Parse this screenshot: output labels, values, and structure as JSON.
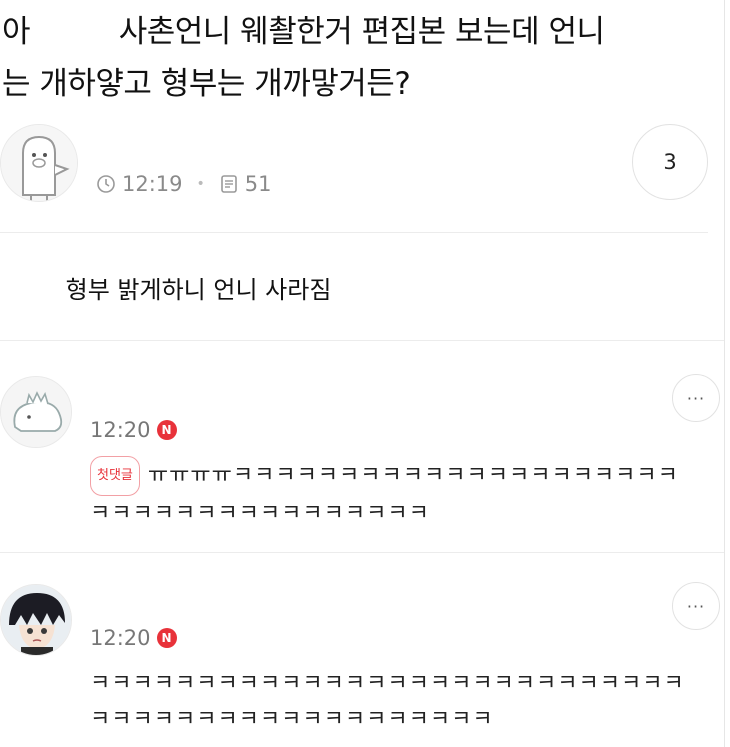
{
  "post": {
    "title_line1_a": "아",
    "title_line1_b": "사촌언니 웨촬한거 편집본 보는데 언니",
    "title_line2": "는 개하얗고 형부는 개까맣거든?",
    "time": "12:19",
    "views": "51",
    "comment_count": "3",
    "body": "형부 밝게하니 언니 사라짐"
  },
  "comments": [
    {
      "time": "12:20",
      "new_badge": "N",
      "first_tag": "첫댓글",
      "text": "ㅠㅠㅠㅠㅋㅋㅋㅋㅋㅋㅋㅋㅋㅋㅋㅋㅋㅋㅋㅋㅋㅋㅋㅋㅋㅋㅋㅋㅋㅋㅋㅋㅋㅋㅋㅋㅋㅋㅋㅋㅋ",
      "more": "···"
    },
    {
      "time": "12:20",
      "new_badge": "N",
      "text": "ㅋㅋㅋㅋㅋㅋㅋㅋㅋㅋㅋㅋㅋㅋㅋㅋㅋㅋㅋㅋㅋㅋㅋㅋㅋㅋㅋㅋㅋㅋㅋㅋㅋㅋㅋㅋㅋㅋㅋㅋㅋㅋㅋㅋㅋㅋㅋ",
      "more": "···"
    }
  ],
  "icons": {
    "clock": "clock-icon",
    "doc": "views-icon"
  },
  "colors": {
    "badge": "#e8323a",
    "meta": "#8a8a8a"
  }
}
